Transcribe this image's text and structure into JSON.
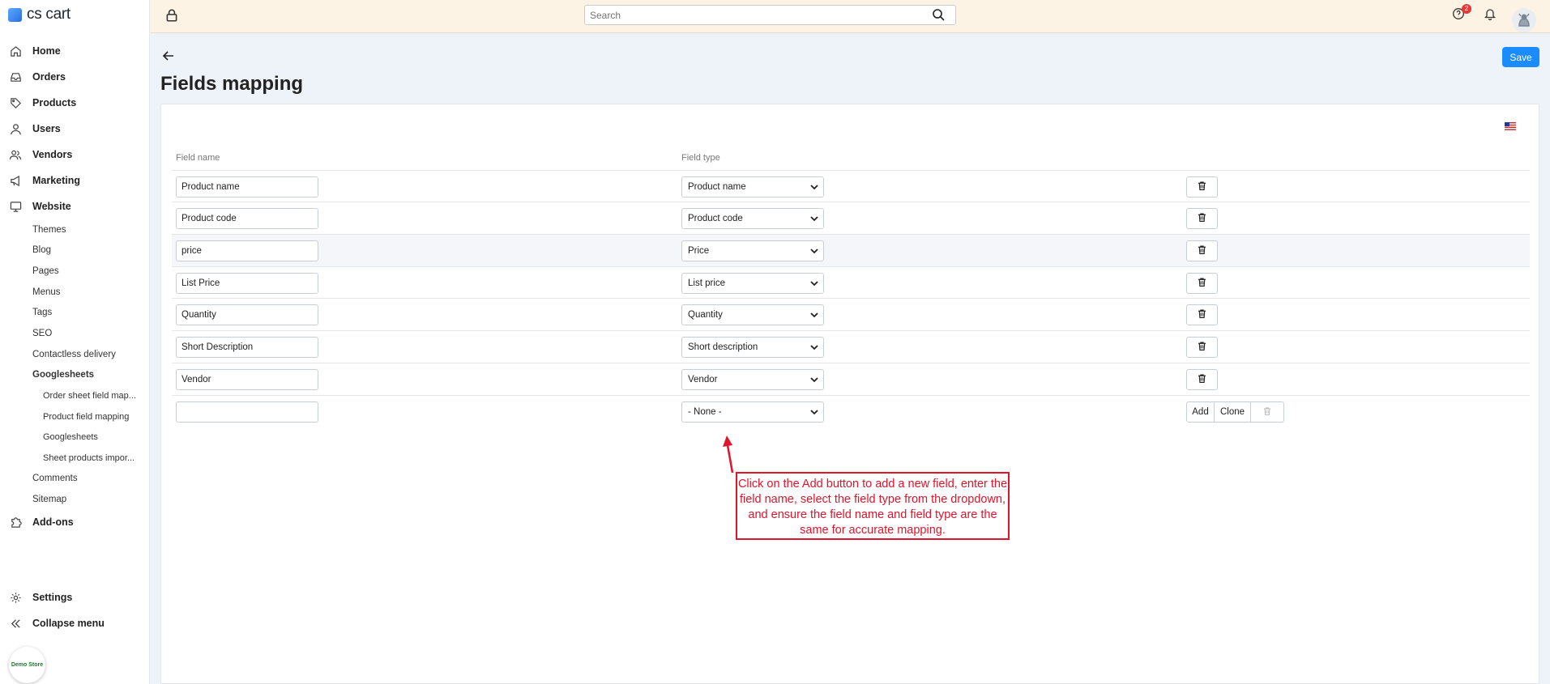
{
  "app": {
    "logo_text": "cs cart"
  },
  "sidebar": {
    "items": [
      {
        "label": "Home",
        "icon": "home-icon"
      },
      {
        "label": "Orders",
        "icon": "inbox-icon"
      },
      {
        "label": "Products",
        "icon": "tag-icon"
      },
      {
        "label": "Users",
        "icon": "user-icon"
      },
      {
        "label": "Vendors",
        "icon": "users-icon"
      },
      {
        "label": "Marketing",
        "icon": "megaphone-icon"
      },
      {
        "label": "Website",
        "icon": "monitor-icon"
      }
    ],
    "website_sub": [
      "Themes",
      "Blog",
      "Pages",
      "Menus",
      "Tags",
      "SEO",
      "Contactless delivery",
      "Googlesheets"
    ],
    "googlesheets_sub": [
      "Order sheet field map...",
      "Product field mapping",
      "Googlesheets",
      "Sheet products impor..."
    ],
    "website_sub_after": [
      "Comments",
      "Sitemap"
    ],
    "addons": "Add-ons",
    "settings": "Settings",
    "collapse": "Collapse menu",
    "demo_store": "Demo Store"
  },
  "topbar": {
    "search_placeholder": "Search",
    "notification_count": "2"
  },
  "page": {
    "title": "Fields mapping",
    "save_label": "Save",
    "col_field_name": "Field name",
    "col_field_type": "Field type"
  },
  "rows": [
    {
      "name": "Product name",
      "type": "Product name"
    },
    {
      "name": "Product code",
      "type": "Product code"
    },
    {
      "name": "price",
      "type": "Price"
    },
    {
      "name": "List Price",
      "type": "List price"
    },
    {
      "name": "Quantity",
      "type": "Quantity"
    },
    {
      "name": "Short Description",
      "type": "Short description"
    },
    {
      "name": "Vendor",
      "type": "Vendor"
    }
  ],
  "new_row": {
    "name": "",
    "type": "- None -",
    "add_label": "Add",
    "clone_label": "Clone"
  },
  "callout": {
    "text": "Click on the Add button to add a new field, enter the field name, select the field type from the dropdown, and ensure the field name and field type are the same for accurate mapping."
  },
  "colors": {
    "accent": "#1a8cff",
    "callout": "#e0142b",
    "topbar": "#fdf3e4"
  }
}
